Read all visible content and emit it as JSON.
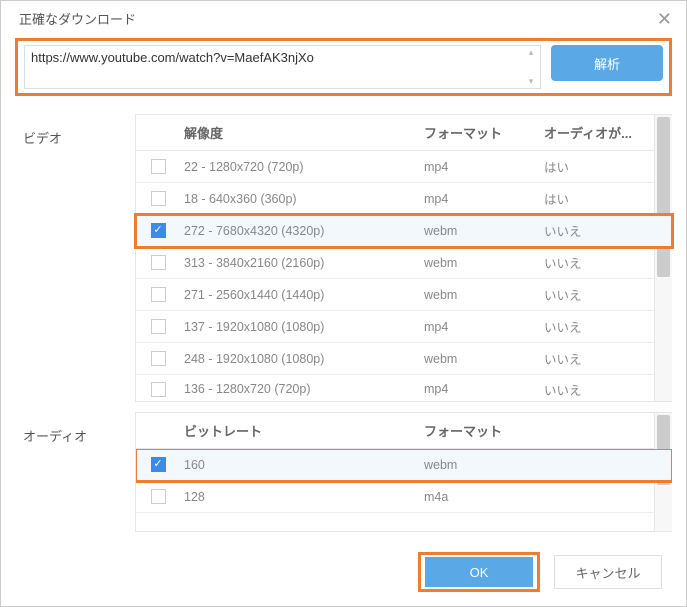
{
  "title": "正確なダウンロード",
  "url": "https://www.youtube.com/watch?v=MaefAK3njXo",
  "analyze": "解析",
  "video_label": "ビデオ",
  "audio_label": "オーディオ",
  "video_headers": {
    "res": "解像度",
    "fmt": "フォーマット",
    "aud": "オーディオが..."
  },
  "audio_headers": {
    "rate": "ビットレート",
    "fmt": "フォーマット"
  },
  "video_rows": [
    {
      "res": "22 - 1280x720 (720p)",
      "fmt": "mp4",
      "aud": "はい",
      "checked": false
    },
    {
      "res": "18 - 640x360 (360p)",
      "fmt": "mp4",
      "aud": "はい",
      "checked": false
    },
    {
      "res": "272 - 7680x4320 (4320p)",
      "fmt": "webm",
      "aud": "いいえ",
      "checked": true
    },
    {
      "res": "313 - 3840x2160 (2160p)",
      "fmt": "webm",
      "aud": "いいえ",
      "checked": false
    },
    {
      "res": "271 - 2560x1440 (1440p)",
      "fmt": "webm",
      "aud": "いいえ",
      "checked": false
    },
    {
      "res": "137 - 1920x1080 (1080p)",
      "fmt": "mp4",
      "aud": "いいえ",
      "checked": false
    },
    {
      "res": "248 - 1920x1080 (1080p)",
      "fmt": "webm",
      "aud": "いいえ",
      "checked": false
    },
    {
      "res": "136 - 1280x720 (720p)",
      "fmt": "mp4",
      "aud": "いいえ",
      "checked": false
    }
  ],
  "audio_rows": [
    {
      "rate": "160",
      "fmt": "webm",
      "checked": true
    },
    {
      "rate": "128",
      "fmt": "m4a",
      "checked": false
    }
  ],
  "ok": "OK",
  "cancel": "キャンセル"
}
